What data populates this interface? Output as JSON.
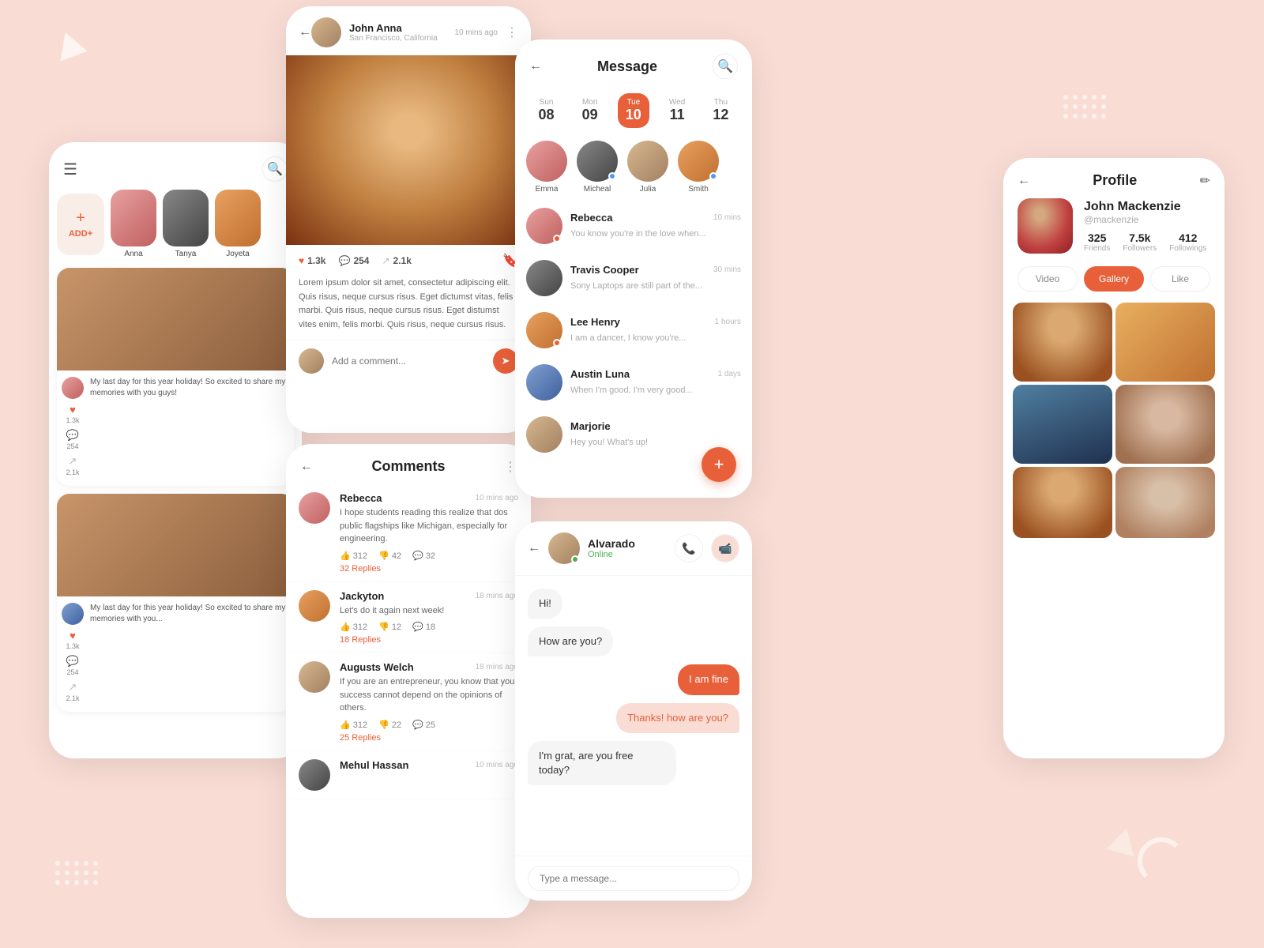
{
  "background": {
    "color": "#f9ddd5"
  },
  "panel_feed": {
    "stories": [
      {
        "name": "ADD+",
        "type": "add"
      },
      {
        "name": "Anna"
      },
      {
        "name": "Tanya"
      },
      {
        "name": "Joyeta"
      }
    ],
    "posts": [
      {
        "caption": "My last day for this year holiday! So excited to share my memories with you guys!",
        "likes": "1.3k",
        "comments": "254",
        "shares": "2.1k"
      },
      {
        "caption": "My last day for this year holiday! So excited to share my memories with you...",
        "likes": "1.3k",
        "comments": "254",
        "shares": "2.1k"
      }
    ]
  },
  "panel_post": {
    "user": {
      "name": "John Anna",
      "location": "San Francisco, California",
      "time": "10 mins ago"
    },
    "stats": {
      "likes": "1.3k",
      "comments": "254",
      "shares": "2.1k"
    },
    "body": "Lorem ipsum dolor sit amet, consectetur adipiscing elit. Quis risus, neque cursus risus. Eget dictumst vitas, felis marbi. Quis risus, neque cursus risus. Eget distumst vites enim, felis morbi. Quis risus, neque cursus risus.",
    "comment_placeholder": "Add a comment..."
  },
  "panel_comments": {
    "title": "Comments",
    "items": [
      {
        "name": "Rebecca",
        "time": "10 mins ago",
        "text": "I hope students reading this realize that dos public flagships like Michigan, especially for engineering.",
        "likes": "312",
        "dislikes": "42",
        "comments": "32",
        "replies_label": "32 Replies"
      },
      {
        "name": "Jackyton",
        "time": "18 mins ago",
        "text": "Let's do it again next week!",
        "likes": "312",
        "dislikes": "12",
        "comments": "18",
        "replies_label": "18 Replies"
      },
      {
        "name": "Augusts Welch",
        "time": "18 mins ago",
        "text": "If you are an entrepreneur, you know that your success cannot depend on the opinions of others.",
        "likes": "312",
        "dislikes": "22",
        "comments": "25",
        "replies_label": "25 Replies"
      },
      {
        "name": "Mehul Hassan",
        "time": "10 mins ago",
        "text": "...",
        "likes": "",
        "dislikes": "",
        "comments": "",
        "replies_label": ""
      }
    ]
  },
  "panel_messages": {
    "title": "Message",
    "dates": [
      {
        "day": "Sun",
        "num": "08",
        "active": false
      },
      {
        "day": "Mon",
        "num": "09",
        "active": false
      },
      {
        "day": "Tue",
        "num": "10",
        "active": true
      },
      {
        "day": "Wed",
        "num": "11",
        "active": false
      },
      {
        "day": "Thu",
        "num": "12",
        "active": false
      }
    ],
    "online_users": [
      {
        "name": "Emma",
        "dot": "none"
      },
      {
        "name": "Micheal",
        "dot": "blue"
      },
      {
        "name": "Julia",
        "dot": "none"
      },
      {
        "name": "Smith",
        "dot": "blue"
      }
    ],
    "conversations": [
      {
        "name": "Rebecca",
        "time": "10 mins",
        "preview": "You know you're in the love when...",
        "unread": true
      },
      {
        "name": "Travis Cooper",
        "time": "30 mins",
        "preview": "Sony Laptops are still part of the...",
        "unread": false
      },
      {
        "name": "Lee Henry",
        "time": "1 hours",
        "preview": "I am a dancer, I know you're...",
        "unread": true
      },
      {
        "name": "Austin Luna",
        "time": "1 days",
        "preview": "When I'm good, I'm very good...",
        "unread": false
      },
      {
        "name": "Marjorie",
        "time": "",
        "preview": "Hey you! What's up!",
        "unread": false
      }
    ],
    "fab_label": "+"
  },
  "panel_chat": {
    "contact": {
      "name": "Alvarado",
      "status": "Online"
    },
    "messages": [
      {
        "text": "Hi!",
        "type": "received"
      },
      {
        "text": "How are you?",
        "type": "received"
      },
      {
        "text": "I am fine",
        "type": "sent"
      },
      {
        "text": "Thanks! how are you?",
        "type": "sent-secondary"
      },
      {
        "text": "I'm grat, are you free today?",
        "type": "received"
      }
    ],
    "input_placeholder": "Type a message..."
  },
  "panel_profile": {
    "title": "Profile",
    "user": {
      "name": "John Mackenzie",
      "handle": "@mackenzie"
    },
    "stats": {
      "friends": {
        "value": "325",
        "label": "Friends"
      },
      "followers": {
        "value": "7.5k",
        "label": "Followers"
      },
      "followings": {
        "value": "412",
        "label": "Followings"
      }
    },
    "tabs": [
      {
        "label": "Video",
        "active": false
      },
      {
        "label": "Gallery",
        "active": true
      },
      {
        "label": "Like",
        "active": false
      }
    ],
    "gallery_count": 6
  },
  "icons": {
    "back": "←",
    "search": "🔍",
    "dots": "⋮",
    "menu": "☰",
    "edit": "✏",
    "heart": "♥",
    "comment": "💬",
    "share": "↗",
    "bookmark": "🔖",
    "send": "➤",
    "phone": "📞",
    "video": "📹",
    "plus": "+",
    "thumbup": "👍",
    "thumbdown": "👎"
  }
}
